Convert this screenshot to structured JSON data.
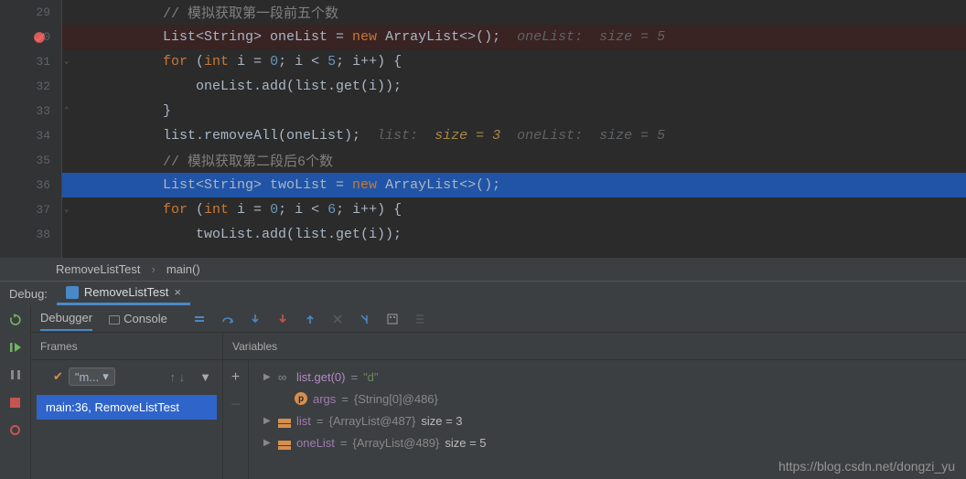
{
  "lines": [
    {
      "num": "29",
      "tokens": [
        {
          "t": "// 模拟获取第一段前五个数",
          "c": "comment"
        }
      ]
    },
    {
      "num": "30",
      "bp": true,
      "hit": true,
      "tokens": [
        {
          "t": "List<String> oneList = ",
          "c": ""
        },
        {
          "t": "new ",
          "c": "kw"
        },
        {
          "t": "ArrayList<>();  ",
          "c": ""
        },
        {
          "t": "oneList:  size = 5",
          "c": "inlay"
        }
      ]
    },
    {
      "num": "31",
      "fold": "down",
      "tokens": [
        {
          "t": "for ",
          "c": "kw"
        },
        {
          "t": "(",
          "c": ""
        },
        {
          "t": "int ",
          "c": "kw"
        },
        {
          "t": "i = ",
          "c": ""
        },
        {
          "t": "0",
          "c": "num"
        },
        {
          "t": "; i < ",
          "c": ""
        },
        {
          "t": "5",
          "c": "num"
        },
        {
          "t": "; i++) {",
          "c": ""
        }
      ]
    },
    {
      "num": "32",
      "tokens": [
        {
          "t": "    oneList.add(list.get(i));",
          "c": ""
        }
      ]
    },
    {
      "num": "33",
      "fold": "up",
      "tokens": [
        {
          "t": "}",
          "c": ""
        }
      ]
    },
    {
      "num": "34",
      "tokens": [
        {
          "t": "list.removeAll(oneList);  ",
          "c": ""
        },
        {
          "t": "list:  ",
          "c": "inlay"
        },
        {
          "t": "size = 3",
          "c": "inlay-hl"
        },
        {
          "t": "  oneList:  size = 5",
          "c": "inlay"
        }
      ]
    },
    {
      "num": "35",
      "tokens": [
        {
          "t": "// 模拟获取第二段后6个数",
          "c": "comment"
        }
      ]
    },
    {
      "num": "36",
      "current": true,
      "tokens": [
        {
          "t": "List<String> twoList = ",
          "c": ""
        },
        {
          "t": "new ",
          "c": "kw"
        },
        {
          "t": "ArrayList<>();",
          "c": ""
        }
      ]
    },
    {
      "num": "37",
      "fold": "down",
      "tokens": [
        {
          "t": "for ",
          "c": "kw"
        },
        {
          "t": "(",
          "c": ""
        },
        {
          "t": "int ",
          "c": "kw"
        },
        {
          "t": "i = ",
          "c": ""
        },
        {
          "t": "0",
          "c": "num"
        },
        {
          "t": "; i < ",
          "c": ""
        },
        {
          "t": "6",
          "c": "num"
        },
        {
          "t": "; i++) {",
          "c": ""
        }
      ]
    },
    {
      "num": "38",
      "tokens": [
        {
          "t": "    twoList.add(list.get(i));",
          "c": ""
        }
      ]
    }
  ],
  "breadcrumb": {
    "cls": "RemoveListTest",
    "method": "main()"
  },
  "debug": {
    "title": "Debug:",
    "tab": "RemoveListTest",
    "debugger_tab": "Debugger",
    "console_tab": "Console",
    "frames_header": "Frames",
    "vars_header": "Variables",
    "thread": "\"m...",
    "frame": "main:36, RemoveListTest"
  },
  "vars": [
    {
      "arrow": true,
      "icon": "link",
      "name": "list.get(0)",
      "eq": " = ",
      "val": "\"d\"",
      "name_c": "var-name",
      "val_c": "var-val"
    },
    {
      "indent": 1,
      "icon": "p",
      "name": "args",
      "eq": " = ",
      "val": "{String[0]@486}",
      "name_c": "var-name2",
      "val_c": "var-gray"
    },
    {
      "arrow": true,
      "icon": "field",
      "name": "list",
      "eq": " = ",
      "val": "{ArrayList@487}",
      "extra": "  size = 3",
      "name_c": "var-name2",
      "val_c": "var-gray"
    },
    {
      "arrow": true,
      "icon": "field",
      "name": "oneList",
      "eq": " = ",
      "val": "{ArrayList@489}",
      "extra": "  size = 5",
      "name_c": "var-name2",
      "val_c": "var-gray"
    }
  ],
  "watermark": "https://blog.csdn.net/dongzi_yu"
}
